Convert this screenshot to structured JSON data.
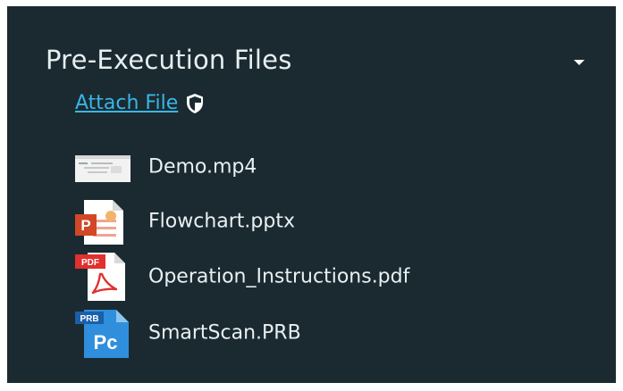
{
  "section": {
    "title": "Pre-Execution Files",
    "attach_label": "Attach File"
  },
  "files": [
    {
      "name": "Demo.mp4",
      "icon": "video-thumbnail-icon"
    },
    {
      "name": "Flowchart.pptx",
      "icon": "powerpoint-icon"
    },
    {
      "name": "Operation_Instructions.pdf",
      "icon": "pdf-icon"
    },
    {
      "name": "SmartScan.PRB",
      "icon": "prb-icon"
    }
  ],
  "icon_text": {
    "powerpoint": "P",
    "pdf": "PDF",
    "prb_badge": "PRB",
    "prb": "Pc"
  },
  "colors": {
    "panel_bg": "#1b2a31",
    "link": "#38b6e6",
    "text": "#e9f0f2",
    "powerpoint": "#d24726",
    "pdf": "#e0312f",
    "prb": "#2f8fdc"
  }
}
